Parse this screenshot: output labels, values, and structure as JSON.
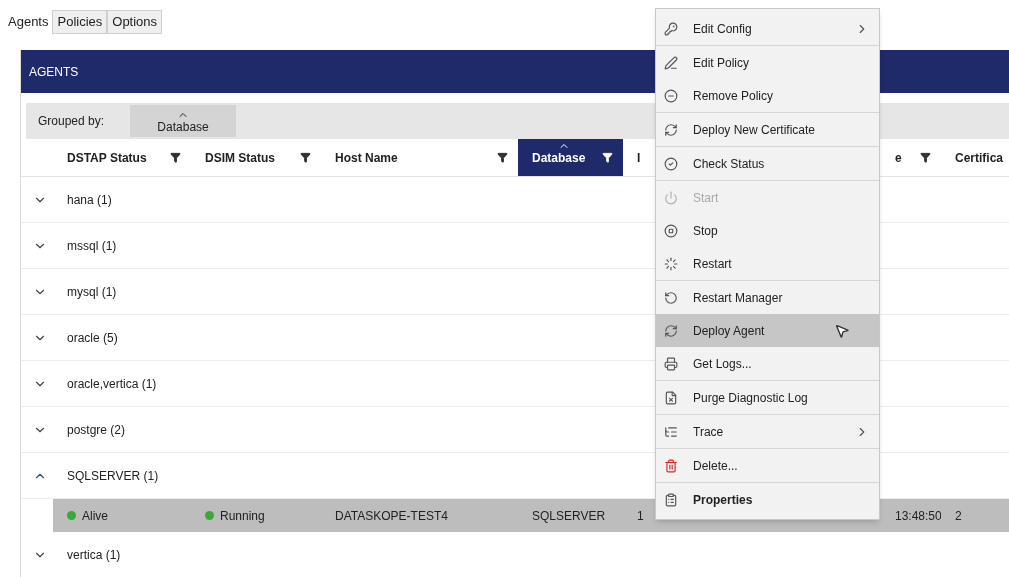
{
  "tabs": [
    {
      "label": "Agents",
      "selected": true
    },
    {
      "label": "Policies",
      "selected": false
    },
    {
      "label": "Options",
      "selected": false
    }
  ],
  "panel": {
    "title": "AGENTS"
  },
  "grouped_by": {
    "label": "Grouped by:",
    "chip": "Database"
  },
  "columns": [
    {
      "label": "DSTAP Status",
      "filter": true,
      "selected": false
    },
    {
      "label": "DSIM Status",
      "filter": true,
      "selected": false
    },
    {
      "label": "Host Name",
      "filter": true,
      "selected": false
    },
    {
      "label": "Database",
      "filter": true,
      "selected": true
    },
    {
      "label": "I",
      "selected": false
    },
    {
      "label": "e",
      "filter": true,
      "selected": false
    },
    {
      "label": "Certifica",
      "selected": false
    }
  ],
  "groups": [
    {
      "label": "hana (1)",
      "expanded": false
    },
    {
      "label": "mssql (1)",
      "expanded": false
    },
    {
      "label": "mysql (1)",
      "expanded": false
    },
    {
      "label": "oracle (5)",
      "expanded": false
    },
    {
      "label": "oracle,vertica (1)",
      "expanded": false
    },
    {
      "label": "postgre (2)",
      "expanded": false
    },
    {
      "label": "SQLSERVER (1)",
      "expanded": true,
      "rows": [
        {
          "selected": true,
          "cells": [
            {
              "text": "Alive",
              "color": "#3aa83a"
            },
            {
              "text": "Running",
              "color": "#3aa83a"
            },
            {
              "text": "DATASKOPE-TEST4"
            },
            {
              "text": "SQLSERVER"
            },
            {
              "text": "1"
            },
            {
              "text": "13:48:50"
            },
            {
              "text": "2"
            }
          ]
        }
      ]
    },
    {
      "label": "vertica (1)",
      "expanded": false
    }
  ],
  "context_menu": {
    "items": [
      {
        "kind": "submenu",
        "label": "Edit Config",
        "disabled": false,
        "selected": false
      },
      {
        "kind": "separator"
      },
      {
        "kind": "command",
        "label": "Edit Policy",
        "disabled": false,
        "selected": false
      },
      {
        "kind": "command",
        "label": "Remove Policy",
        "disabled": false,
        "selected": false
      },
      {
        "kind": "separator"
      },
      {
        "kind": "command",
        "label": "Deploy New Certificate",
        "disabled": false,
        "selected": false
      },
      {
        "kind": "separator"
      },
      {
        "kind": "command",
        "label": "Check Status",
        "disabled": false,
        "selected": false
      },
      {
        "kind": "separator"
      },
      {
        "kind": "command",
        "label": "Start",
        "disabled": true,
        "selected": false
      },
      {
        "kind": "command",
        "label": "Stop",
        "disabled": false,
        "selected": false
      },
      {
        "kind": "command",
        "label": "Restart",
        "disabled": false,
        "selected": false
      },
      {
        "kind": "separator"
      },
      {
        "kind": "command",
        "label": "Restart Manager",
        "disabled": false,
        "selected": false
      },
      {
        "kind": "command",
        "label": "Deploy Agent",
        "disabled": false,
        "selected": true
      },
      {
        "kind": "command",
        "label": "Get Logs...",
        "disabled": false,
        "selected": false
      },
      {
        "kind": "separator"
      },
      {
        "kind": "command",
        "label": "Purge Diagnostic Log",
        "disabled": false,
        "selected": false
      },
      {
        "kind": "separator"
      },
      {
        "kind": "submenu",
        "label": "Trace",
        "disabled": false,
        "selected": false
      },
      {
        "kind": "separator"
      },
      {
        "kind": "command",
        "label": "Delete...",
        "disabled": false,
        "selected": false
      },
      {
        "kind": "separator"
      },
      {
        "kind": "default",
        "label": "Properties",
        "disabled": false,
        "selected": false
      }
    ]
  }
}
